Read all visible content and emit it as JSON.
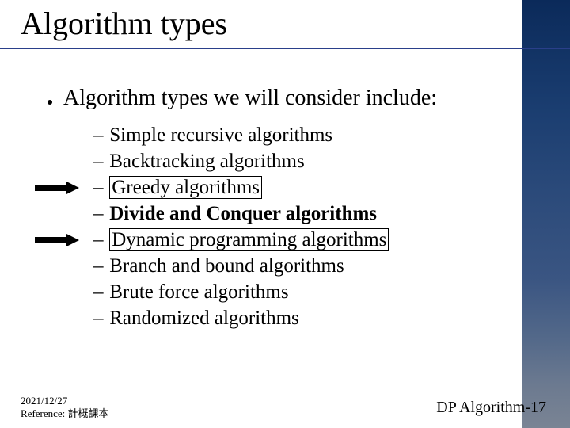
{
  "title": "Algorithm types",
  "bullet": "Algorithm types we will consider include:",
  "items": [
    {
      "text": "Simple recursive algorithms",
      "bold": false,
      "boxed": false,
      "arrow": false
    },
    {
      "text": "Backtracking algorithms",
      "bold": false,
      "boxed": false,
      "arrow": false
    },
    {
      "text": "Greedy algorithms",
      "bold": false,
      "boxed": true,
      "arrow": true
    },
    {
      "text": "Divide and Conquer algorithms",
      "bold": true,
      "boxed": false,
      "arrow": false
    },
    {
      "text": "Dynamic programming algorithms",
      "bold": false,
      "boxed": true,
      "arrow": true
    },
    {
      "text": "Branch and bound algorithms",
      "bold": false,
      "boxed": false,
      "arrow": false
    },
    {
      "text": "Brute force algorithms",
      "bold": false,
      "boxed": false,
      "arrow": false
    },
    {
      "text": "Randomized algorithms",
      "bold": false,
      "boxed": false,
      "arrow": false
    }
  ],
  "footer": {
    "date": "2021/12/27",
    "reference": "Reference: 計概課本"
  },
  "page_label": "DP Algorithm-17"
}
